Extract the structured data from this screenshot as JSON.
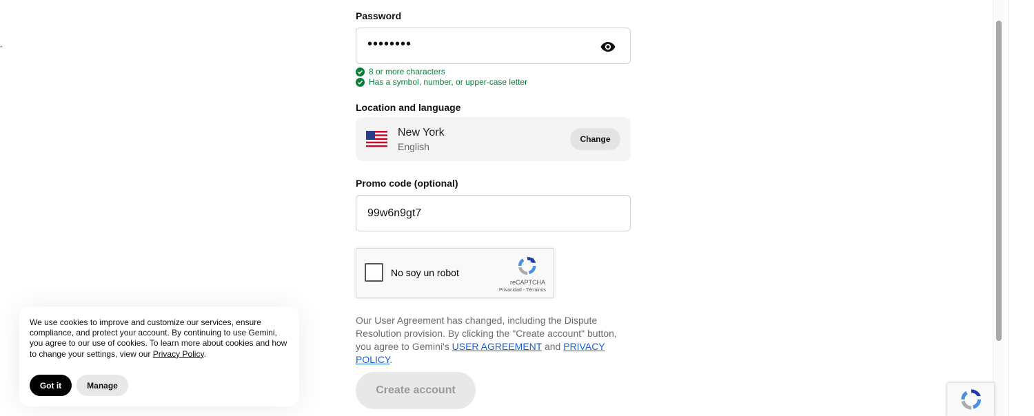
{
  "password": {
    "label": "Password",
    "value": "••••••••",
    "visibility_icon": "eye-icon",
    "requirements": [
      {
        "text": "8 or more characters",
        "icon": "check-circle-icon",
        "met": true
      },
      {
        "text": "Has a symbol, number, or upper-case letter",
        "icon": "check-circle-icon",
        "met": true
      }
    ]
  },
  "location": {
    "label": "Location and language",
    "flag_icon": "us-flag-icon",
    "city": "New York",
    "language": "English",
    "change_label": "Change"
  },
  "promo": {
    "label": "Promo code (optional)",
    "value": "99w6n9gt7"
  },
  "recaptcha": {
    "checkbox_label": "No soy un robot",
    "brand": "reCAPTCHA",
    "links": "Privacidad - Términos"
  },
  "agreement": {
    "text_before": "Our User Agreement has changed, including the Dispute Resolution provision. By clicking the \"Create account\" button, you agree to Gemini's ",
    "user_agreement_link": "USER AGREEMENT",
    "and_text": " and ",
    "privacy_link": "PRIVACY POLICY",
    "end": "."
  },
  "create_account_label": "Create account",
  "cookie_banner": {
    "text": "We use cookies to improve and customize our services, ensure compliance, and protect your account. By continuing to use Gemini, you agree to our use of cookies. To learn more about cookies and how to change your settings, view our ",
    "privacy_link": "Privacy Policy",
    "end": ".",
    "got_it_label": "Got it",
    "manage_label": "Manage"
  },
  "colors": {
    "success_green": "#0a7d3c",
    "link_blue": "#1a5fd6",
    "disabled_button": "#e8e8e8"
  }
}
